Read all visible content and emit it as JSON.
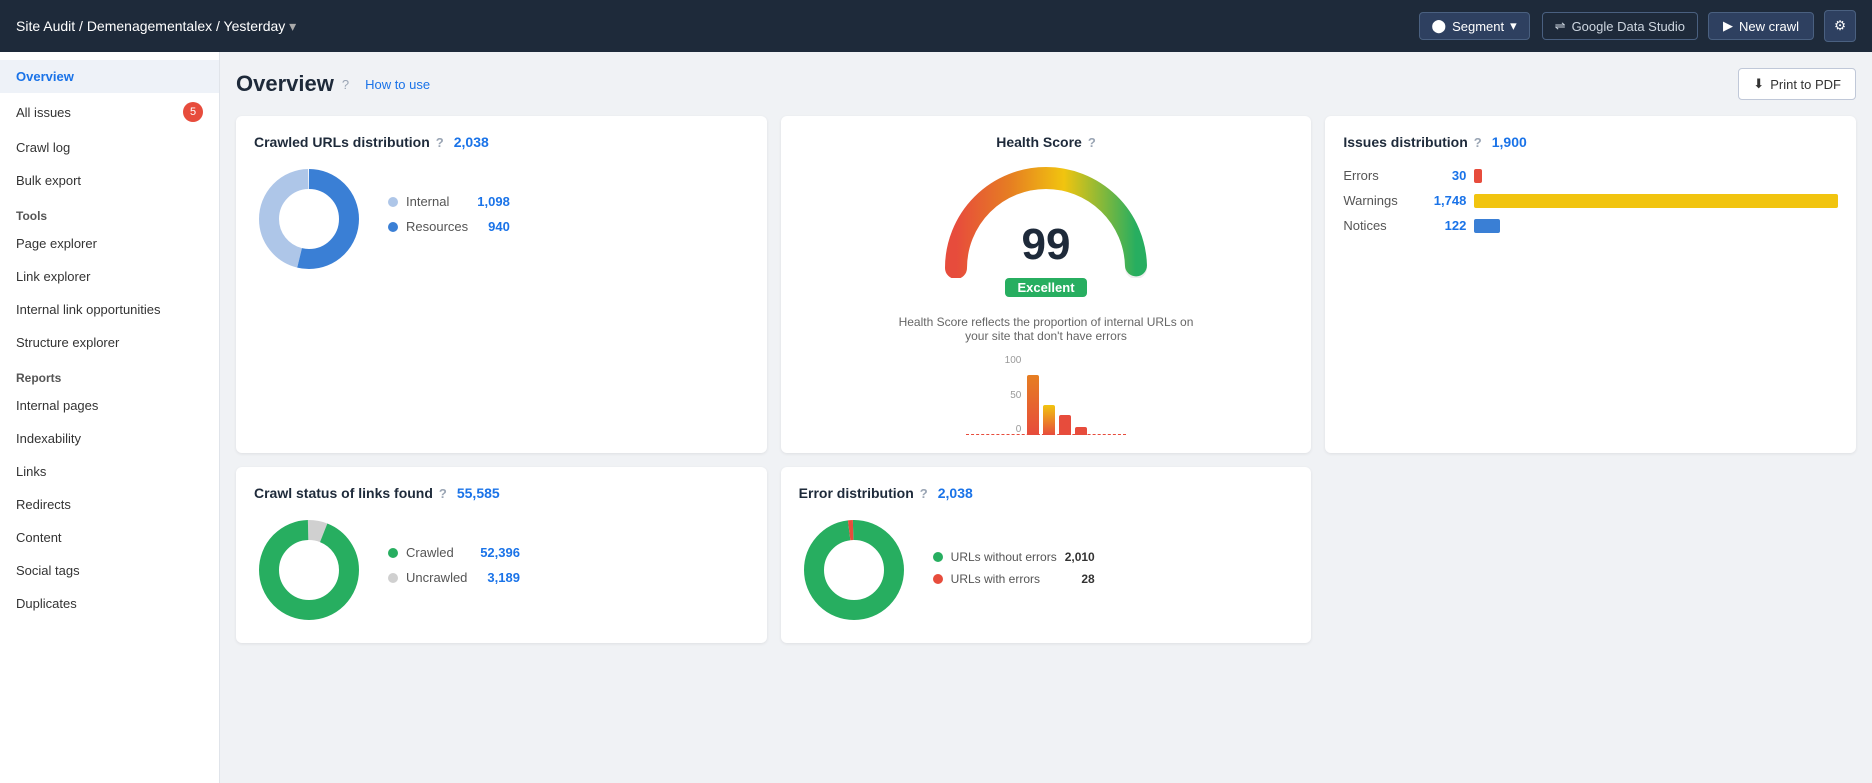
{
  "topnav": {
    "breadcrumb": "Site Audit / Demenagementalex / Yesterday",
    "segment_label": "Segment",
    "gds_label": "Google Data Studio",
    "new_crawl_label": "New crawl"
  },
  "page_header": {
    "title": "Overview",
    "how_to_use": "How to use",
    "print_label": "Print to PDF"
  },
  "sidebar": {
    "overview": "Overview",
    "all_issues": "All issues",
    "all_issues_badge": "5",
    "crawl_log": "Crawl log",
    "bulk_export": "Bulk export",
    "tools_label": "Tools",
    "page_explorer": "Page explorer",
    "link_explorer": "Link explorer",
    "internal_link_opp": "Internal link opportunities",
    "structure_explorer": "Structure explorer",
    "reports_label": "Reports",
    "internal_pages": "Internal pages",
    "indexability": "Indexability",
    "links": "Links",
    "redirects": "Redirects",
    "content": "Content",
    "social_tags": "Social tags",
    "duplicates": "Duplicates"
  },
  "crawled_urls": {
    "title": "Crawled URLs distribution",
    "total": "2,038",
    "internal_label": "Internal",
    "internal_val": "1,098",
    "resources_label": "Resources",
    "resources_val": "940",
    "internal_pct": 54,
    "resources_pct": 46
  },
  "health_score": {
    "title": "Health Score",
    "score": "99",
    "badge": "Excellent",
    "description": "Health Score reflects the proportion of internal URLs on your site that don't have errors",
    "bar_labels": [
      "100",
      "50",
      "0"
    ]
  },
  "issues_dist": {
    "title": "Issues distribution",
    "total": "1,900",
    "errors_label": "Errors",
    "errors_val": "30",
    "warnings_label": "Warnings",
    "warnings_val": "1,748",
    "notices_label": "Notices",
    "notices_val": "122",
    "errors_pct": 2,
    "warnings_pct": 100,
    "notices_pct": 7
  },
  "crawl_status": {
    "title": "Crawl status of links found",
    "total": "55,585",
    "crawled_label": "Crawled",
    "crawled_val": "52,396",
    "uncrawled_label": "Uncrawled",
    "uncrawled_val": "3,189"
  },
  "error_dist": {
    "title": "Error distribution",
    "total": "2,038",
    "no_error_label": "URLs without errors",
    "no_error_val": "2,010",
    "error_label": "URLs with errors",
    "error_val": "28"
  }
}
